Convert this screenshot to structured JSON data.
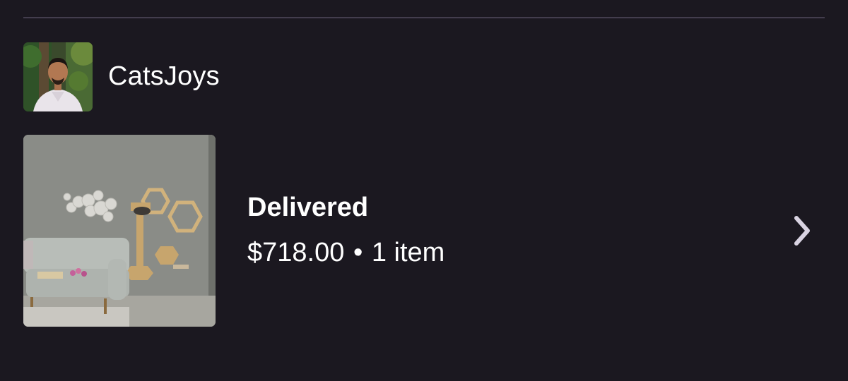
{
  "shop": {
    "name": "CatsJoys",
    "avatar_icon": "seller-avatar"
  },
  "order": {
    "status": "Delivered",
    "price": "$718.00",
    "separator": "•",
    "items": "1 item",
    "thumbnail_icon": "cat-wall-shelves-product-photo"
  },
  "icons": {
    "chevron": "chevron-right-icon"
  },
  "colors": {
    "background": "#1b1820",
    "divider": "#433d4d",
    "text": "#ffffff",
    "chevron": "#d9d3e2"
  }
}
